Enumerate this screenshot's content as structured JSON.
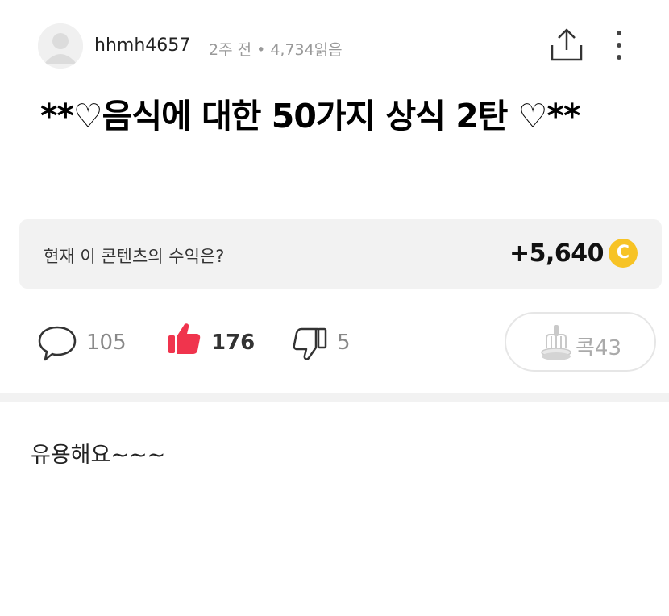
{
  "post": {
    "author": "hhmh4657",
    "time_ago": "2주 전",
    "separator": "•",
    "read_count": "4,734읽음",
    "title": "**♡음식에 대한 50가지 상식 2탄 ♡**",
    "body": "유용해요~~~"
  },
  "revenue": {
    "label": "현재 이 콘텐츠의 수익은?",
    "value": "+5,640",
    "coin_letter": "C"
  },
  "actions": {
    "comments": "105",
    "likes": "176",
    "dislikes": "5",
    "kok_label": "콕43"
  },
  "icons": [
    "avatar-placeholder-icon",
    "share-icon",
    "more-vertical-icon",
    "comment-icon",
    "thumbs-up-icon",
    "thumbs-down-icon",
    "kok-icon",
    "coin-icon"
  ],
  "colors": {
    "like": "#f0344d",
    "coin": "#f7c325",
    "panel": "#f2f2f2",
    "muted": "#999999"
  }
}
